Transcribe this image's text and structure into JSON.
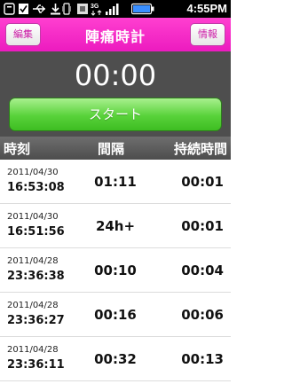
{
  "status_bar": {
    "time": "4:55PM"
  },
  "header": {
    "title": "陣痛時計",
    "left_button": "編集",
    "right_button": "情報"
  },
  "timer": {
    "display": "00:00",
    "start_label": "スタート"
  },
  "columns": {
    "time": "時刻",
    "interval": "間隔",
    "duration": "持続時間"
  },
  "rows": [
    {
      "date": "2011/04/30",
      "clock": "16:53:08",
      "interval": "01:11",
      "duration": "00:01"
    },
    {
      "date": "2011/04/30",
      "clock": "16:51:56",
      "interval": "24h+",
      "duration": "00:01"
    },
    {
      "date": "2011/04/28",
      "clock": "23:36:38",
      "interval": "00:10",
      "duration": "00:04"
    },
    {
      "date": "2011/04/28",
      "clock": "23:36:27",
      "interval": "00:16",
      "duration": "00:06"
    },
    {
      "date": "2011/04/28",
      "clock": "23:36:11",
      "interval": "00:32",
      "duration": "00:13"
    }
  ],
  "colors": {
    "accent": "#ec1bbf",
    "start_green": "#58d23a",
    "panel": "#4e4e4e"
  },
  "icons": [
    "notification-icon",
    "checkbox-icon",
    "usb-icon",
    "download-icon",
    "vibrate-icon",
    "sim-icon",
    "3g-icon",
    "signal-icon",
    "battery-icon"
  ]
}
